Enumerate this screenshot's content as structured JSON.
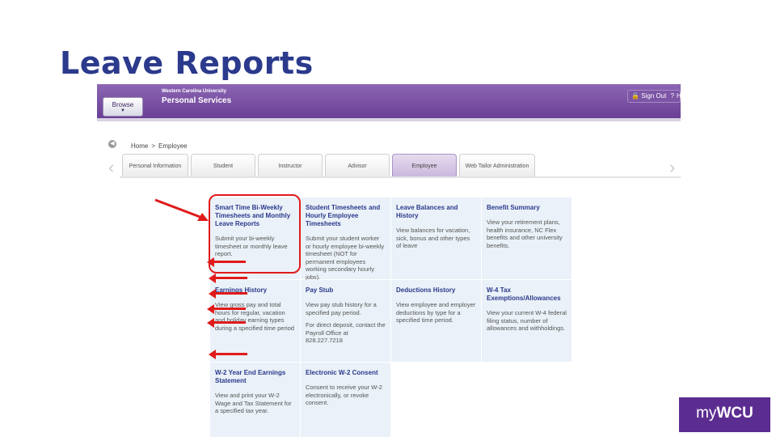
{
  "slide": {
    "title": "Leave Reports"
  },
  "app": {
    "browse_label": "Browse",
    "org_name": "Western Carolina University",
    "org_sub": "Personal Services",
    "sign_out": "Sign Out",
    "help": "He"
  },
  "breadcrumb": {
    "home": "Home",
    "current": "Employee"
  },
  "tabs": [
    {
      "label": "Personal Information"
    },
    {
      "label": "Student"
    },
    {
      "label": "Instructor"
    },
    {
      "label": "Advisor"
    },
    {
      "label": "Employee"
    },
    {
      "label": "Web Tailor Administration"
    }
  ],
  "tiles": [
    {
      "title": "Smart Time Bi-Weekly Timesheets and Monthly Leave Reports",
      "desc": "Submit your bi-weekly timesheet or monthly leave report.",
      "extra": ""
    },
    {
      "title": "Student Timesheets and Hourly Employee Timesheets",
      "desc": "Submit your student worker or hourly employee bi-weekly timesheet (NOT for permanent employees working secondary hourly jobs).",
      "extra": ""
    },
    {
      "title": "Leave Balances and History",
      "desc": "View balances for vacation, sick, bonus and other types of leave",
      "extra": ""
    },
    {
      "title": "Benefit Summary",
      "desc": "View your retirement plans, health insurance, NC Flex benefits and other university benefits.",
      "extra": ""
    },
    {
      "title": "Earnings History",
      "desc": "View gross pay and total hours for regular, vacation and holiday earning types during a specified time period",
      "extra": ""
    },
    {
      "title": "Pay Stub",
      "desc": "View pay stub history for a specified pay period.",
      "extra": "For direct deposit, contact the Payroll Office at 828.227.7218"
    },
    {
      "title": "Deductions History",
      "desc": "View employee and employer deductions by type for a specified time period.",
      "extra": ""
    },
    {
      "title": "W-4 Tax Exemptions/Allowances",
      "desc": "View your current W-4 federal filing status, number of allowances and withholdings.",
      "extra": ""
    },
    {
      "title": "W-2 Year End Earnings Statement",
      "desc": "View and print your W-2 Wage and Tax Statement for a specified tax year.",
      "extra": ""
    },
    {
      "title": "Electronic W-2 Consent",
      "desc": "Consent to receive your W-2 electronically, or revoke consent.",
      "extra": ""
    }
  ],
  "logo": {
    "my": "my",
    "wcu": "WCU"
  },
  "colors": {
    "accent_purple": "#6a3f96",
    "annotation_red": "#e01b1b",
    "title_blue": "#2b3a8c"
  }
}
